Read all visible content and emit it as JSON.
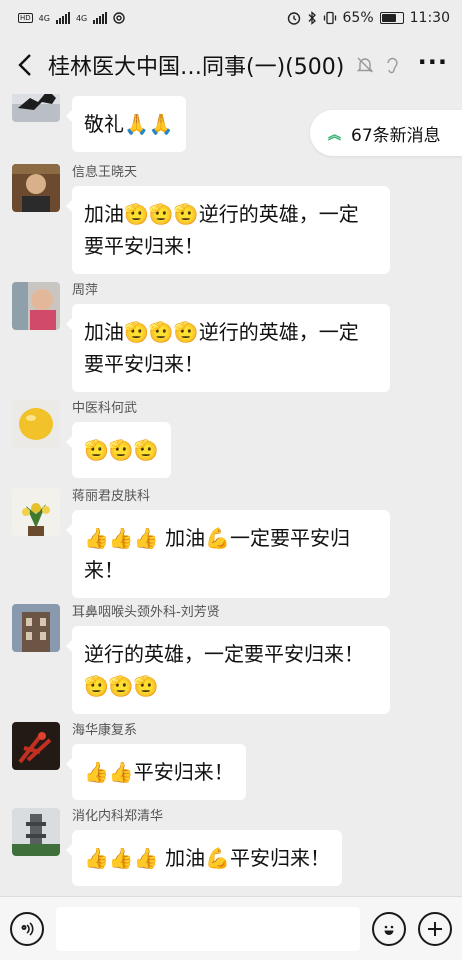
{
  "status_bar": {
    "network_1": "4G",
    "network_2": "4G",
    "battery": "65%",
    "time": "11:30"
  },
  "nav": {
    "title": "桂林医大中国…同事(一)(500)"
  },
  "unread": {
    "label": "67条新消息"
  },
  "messages": [
    {
      "sender": "",
      "text": "敬礼🙏🙏"
    },
    {
      "sender": "信息王晓天",
      "text": "加油🫡🫡🫡逆行的英雄，一定要平安归来！"
    },
    {
      "sender": "周萍",
      "text": "加油🫡🫡🫡逆行的英雄，一定要平安归来！"
    },
    {
      "sender": "中医科何武",
      "text": "🫡🫡🫡"
    },
    {
      "sender": "蒋丽君皮肤科",
      "text": "👍👍👍 加油💪一定要平安归来！"
    },
    {
      "sender": "耳鼻咽喉头颈外科-刘芳贤",
      "text": "逆行的英雄，一定要平安归来！🫡🫡🫡"
    },
    {
      "sender": "海华康复系",
      "text": "👍👍平安归来！"
    },
    {
      "sender": "消化内科郑清华",
      "text": "👍👍👍 加油💪平安归来！"
    }
  ],
  "input": {
    "placeholder": ""
  }
}
